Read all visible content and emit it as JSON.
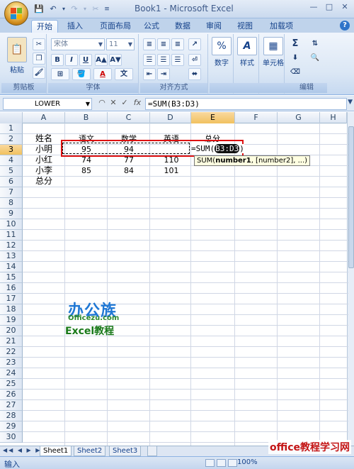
{
  "window": {
    "title": "Book1 - Microsoft Excel"
  },
  "ribbon": {
    "tabs": [
      {
        "label": "开始",
        "active": true
      },
      {
        "label": "插入"
      },
      {
        "label": "页面布局"
      },
      {
        "label": "公式"
      },
      {
        "label": "数据"
      },
      {
        "label": "审阅"
      },
      {
        "label": "视图"
      },
      {
        "label": "加载项"
      }
    ],
    "clipboard": {
      "paste_label": "粘贴",
      "group_label": "剪贴板"
    },
    "font": {
      "font_name": "宋体",
      "font_size": "11",
      "group_label": "字体",
      "bold": "B",
      "italic": "I",
      "underline": "U",
      "font_color": "A"
    },
    "alignment": {
      "group_label": "对齐方式"
    },
    "number": {
      "label": "数字",
      "percent": "%"
    },
    "styles": {
      "label": "样式"
    },
    "cells": {
      "label": "单元格"
    },
    "editing": {
      "group_label": "编辑",
      "sum": "Σ"
    }
  },
  "formula_bar": {
    "name_box": "LOWER",
    "fx": "fx",
    "formula": "=SUM(B3:D3)"
  },
  "grid": {
    "columns": [
      "A",
      "B",
      "C",
      "D",
      "E",
      "F",
      "G",
      "H"
    ],
    "rows": [
      "1",
      "2",
      "3",
      "4",
      "5",
      "6",
      "7",
      "8",
      "9",
      "10",
      "11",
      "12",
      "13",
      "14",
      "15",
      "16",
      "17",
      "18",
      "19",
      "20",
      "21",
      "22",
      "23",
      "24",
      "25",
      "26",
      "27",
      "28",
      "29",
      "30"
    ],
    "cells": {
      "A2": "姓名",
      "B2": "语文",
      "C2": "数学",
      "D2": "英语",
      "E2": "总分",
      "A3": "小明",
      "B3": "95",
      "C3": "94",
      "A4": "小红",
      "B4": "74",
      "C4": "77",
      "D4": "110",
      "A5": "小李",
      "B5": "85",
      "C5": "84",
      "D5": "101",
      "A6": "总分"
    },
    "editing_prefix": "=SUM(",
    "editing_ref": "B3:D3",
    "editing_suffix": ")",
    "tooltip_fn": "SUM(",
    "tooltip_arg1": "number1",
    "tooltip_rest": ", [number2], ...)"
  },
  "watermark": {
    "logo": "办公族",
    "site": "Officezu.com",
    "excel": "Excel教程",
    "bottom": "office教程学习网"
  },
  "sheets": [
    "Sheet1",
    "Sheet2",
    "Sheet3"
  ],
  "status": {
    "mode": "输入",
    "zoom": "100%"
  }
}
